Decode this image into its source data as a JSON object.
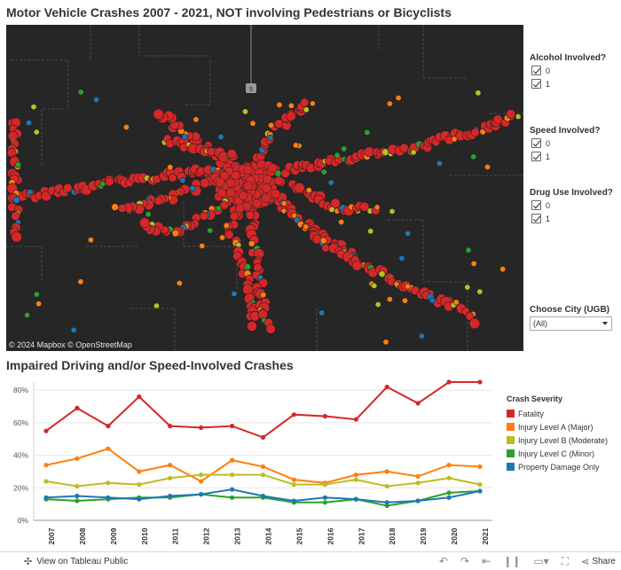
{
  "header": {
    "title": "Motor Vehicle Crashes 2007 - 2021, NOT involving Pedestrians or Bicyclists"
  },
  "map": {
    "attribution": "© 2024 Mapbox © OpenStreetMap",
    "shield_label": "5"
  },
  "filters": [
    {
      "title": "Alcohol Involved?",
      "options": [
        "0",
        "1"
      ]
    },
    {
      "title": "Speed Involved?",
      "options": [
        "0",
        "1"
      ]
    },
    {
      "title": "Drug Use Involved?",
      "options": [
        "0",
        "1"
      ]
    }
  ],
  "city": {
    "label": "Choose City (UGB)",
    "value": "(All)"
  },
  "chart": {
    "title": "Impaired Driving and/or Speed-Involved Crashes"
  },
  "legend": {
    "title": "Crash Severity"
  },
  "colors": {
    "fatality": "#d62728",
    "injury_a": "#ff7f0e",
    "injury_b": "#bcbd22",
    "injury_c": "#2ca02c",
    "pdo": "#1f77b4"
  },
  "chart_data": {
    "type": "line",
    "title": "Impaired Driving and/or Speed-Involved Crashes",
    "x": [
      "2007",
      "2008",
      "2009",
      "2010",
      "2011",
      "2012",
      "2013",
      "2014",
      "2015",
      "2016",
      "2017",
      "2018",
      "2019",
      "2020",
      "2021"
    ],
    "yticks": [
      "0%",
      "20%",
      "40%",
      "60%",
      "80%"
    ],
    "ylim": [
      0,
      0.85
    ],
    "series": [
      {
        "name": "Fatality",
        "color": "#d62728",
        "values": [
          0.55,
          0.69,
          0.58,
          0.76,
          0.58,
          0.57,
          0.58,
          0.51,
          0.65,
          0.64,
          0.62,
          0.82,
          0.72,
          0.85,
          0.85
        ]
      },
      {
        "name": "Injury Level A (Major)",
        "color": "#ff7f0e",
        "values": [
          0.34,
          0.38,
          0.44,
          0.3,
          0.34,
          0.24,
          0.37,
          0.33,
          0.25,
          0.23,
          0.28,
          0.3,
          0.27,
          0.34,
          0.33
        ]
      },
      {
        "name": "Injury Level B (Moderate)",
        "color": "#bcbd22",
        "values": [
          0.24,
          0.21,
          0.23,
          0.22,
          0.26,
          0.28,
          0.28,
          0.28,
          0.22,
          0.22,
          0.25,
          0.21,
          0.23,
          0.26,
          0.22
        ]
      },
      {
        "name": "Injury Level C (Minor)",
        "color": "#2ca02c",
        "values": [
          0.13,
          0.12,
          0.13,
          0.14,
          0.14,
          0.16,
          0.14,
          0.14,
          0.11,
          0.11,
          0.13,
          0.09,
          0.12,
          0.17,
          0.18
        ]
      },
      {
        "name": "Property Damage Only",
        "color": "#1f77b4",
        "values": [
          0.14,
          0.15,
          0.14,
          0.13,
          0.15,
          0.16,
          0.19,
          0.15,
          0.12,
          0.14,
          0.13,
          0.11,
          0.12,
          0.14,
          0.18
        ]
      }
    ],
    "legend": "right",
    "grid": true
  },
  "footer": {
    "view_label": "View on Tableau Public",
    "share_label": "Share"
  }
}
